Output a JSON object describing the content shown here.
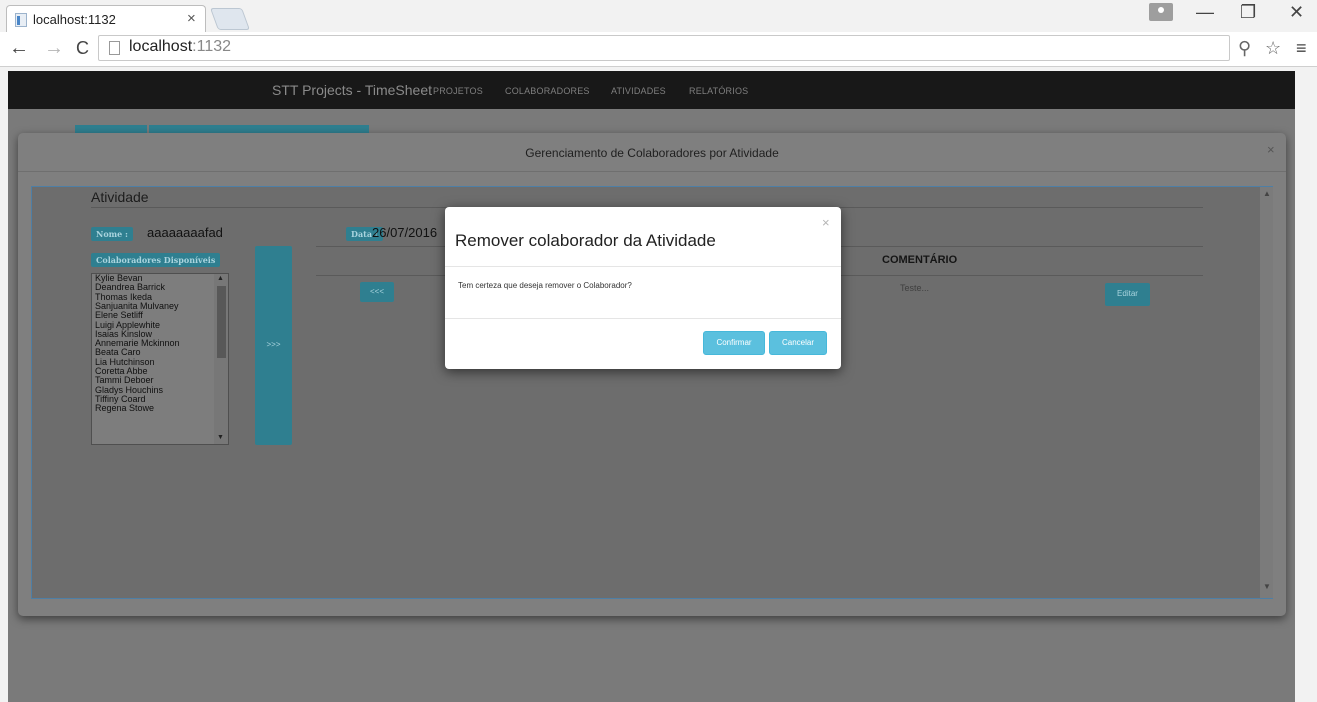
{
  "browser": {
    "tab_title": "localhost:1132",
    "tab_close": "×",
    "url_host": "localhost",
    "url_port": ":1132",
    "window_controls": {
      "minimize": "—",
      "maximize": "❐",
      "close": "✕"
    }
  },
  "navbar": {
    "brand": "STT Projects - TimeSheet",
    "links": [
      "PROJETOS",
      "COLABORADORES",
      "ATIVIDADES",
      "RELATÓRIOS"
    ]
  },
  "outer_modal": {
    "title": "Gerenciamento de Colaboradores por Atividade",
    "close": "×",
    "section_title": "Atividade",
    "nome_label": "Nome :",
    "nome_value": "aaaaaaaafad",
    "data_label": "Data :",
    "data_value": "26/07/2016",
    "available_label": "Colaboradores Disponíveis",
    "available": [
      "Kylie Bevan",
      "Deandrea Barrick",
      "Thomas Ikeda",
      "Sanjuanita Mulvaney",
      "Elene Setliff",
      "Luigi Applewhite",
      "Isaias Kinslow",
      "Annemarie Mckinnon",
      "Beata Caro",
      "Lia Hutchinson",
      "Coretta Abbe",
      "Tammi Deboer",
      "Gladys Houchins",
      "Tiffiny Coard",
      "Regena Stowe"
    ],
    "add_button": ">>>",
    "remove_button": "<<<",
    "column_header": "COMENTÁRIO",
    "row_comment": "Teste...",
    "edit_button": "Editar"
  },
  "dialog": {
    "title": "Remover colaborador da Atividade",
    "close": "×",
    "message": "Tem certeza que deseja remover o Colaborador?",
    "confirm_label": "Confirmar",
    "cancel_label": "Cancelar"
  },
  "colors": {
    "navbar_bg": "#181818",
    "backdrop": "#7a7a7a",
    "accent_teal": "#2f7f90",
    "button_info": "#5bc0de"
  },
  "icons": [
    "back-arrow-icon",
    "forward-arrow-icon",
    "reload-icon",
    "page-icon",
    "zoom-icon",
    "star-icon",
    "menu-icon",
    "user-icon"
  ]
}
